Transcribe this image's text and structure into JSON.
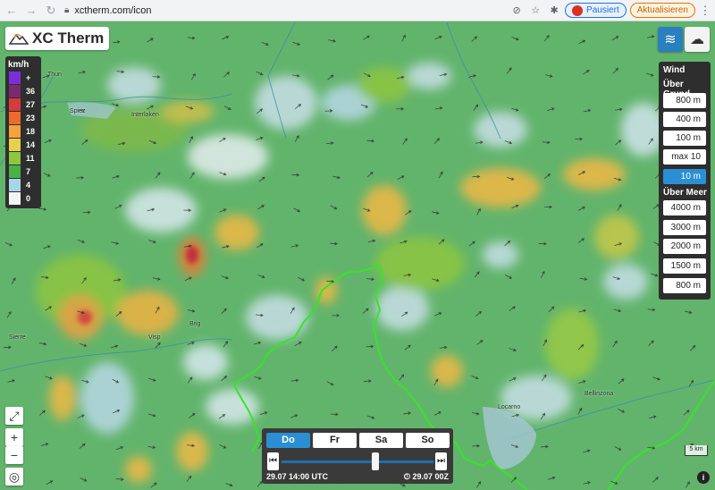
{
  "browser": {
    "url": "xctherm.com/icon",
    "profile_label": "Pausiert",
    "update_label": "Aktualisieren"
  },
  "app": {
    "logo_text": "XC Therm"
  },
  "legend": {
    "unit": "km/h",
    "rows": [
      {
        "label": "+",
        "color": "#7c2fd8"
      },
      {
        "label": "36",
        "color": "#7a2a6e"
      },
      {
        "label": "27",
        "color": "#d63a3a"
      },
      {
        "label": "23",
        "color": "#ec6a2c"
      },
      {
        "label": "18",
        "color": "#f4a23c"
      },
      {
        "label": "14",
        "color": "#e8d04a"
      },
      {
        "label": "11",
        "color": "#8ec63f"
      },
      {
        "label": "7",
        "color": "#49b04a"
      },
      {
        "label": "4",
        "color": "#a8d4e8"
      },
      {
        "label": "0",
        "color": "#f4f4f4"
      }
    ]
  },
  "panel": {
    "title": "Wind",
    "ground_title": "Über Grund",
    "ground_levels": [
      "800 m",
      "400 m",
      "100 m",
      "max 10 m",
      "10 m"
    ],
    "active_level": "10 m",
    "sea_title": "Über Meer",
    "sea_levels": [
      "4000 m",
      "3000 m",
      "2000 m",
      "1500 m",
      "800 m"
    ]
  },
  "time": {
    "days": [
      "Do",
      "Fr",
      "Sa",
      "So"
    ],
    "active_day": "Do",
    "current": "29.07 14:00 UTC",
    "end": "29.07 00Z",
    "position": 0.62
  },
  "map": {
    "scale": "5 km",
    "places": [
      "Thun",
      "Spiez",
      "Interlaken",
      "Sierre",
      "Visp",
      "Brig",
      "Locarno",
      "Bellinzona"
    ]
  },
  "colors": {
    "accent": "#2b8fd3",
    "border": "#39e32b"
  }
}
